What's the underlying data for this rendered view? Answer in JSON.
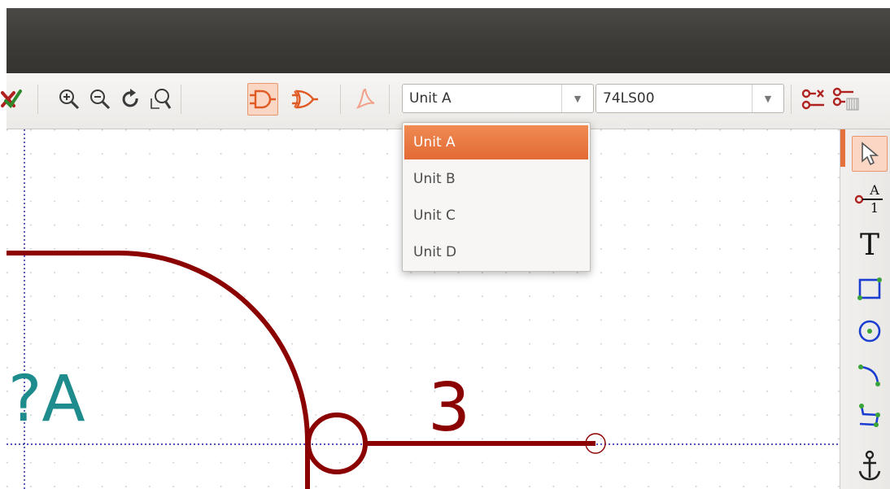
{
  "toolbar": {
    "buttons": [
      {
        "name": "delete-icon"
      },
      {
        "name": "zoom-in-icon"
      },
      {
        "name": "zoom-out-icon"
      },
      {
        "name": "redraw-icon"
      },
      {
        "name": "zoom-fit-icon"
      },
      {
        "name": "and-gate-icon",
        "active": true
      },
      {
        "name": "or-gate-icon"
      },
      {
        "name": "pdf-icon"
      }
    ],
    "unit_select": {
      "value": "Unit A",
      "expanded": true
    },
    "part_select": {
      "value": "74LS00"
    },
    "right_buttons": [
      {
        "name": "pin-table-icon"
      },
      {
        "name": "pin-list-icon"
      }
    ]
  },
  "unit_dropdown": {
    "options": [
      "Unit A",
      "Unit B",
      "Unit C",
      "Unit D"
    ],
    "selected": "Unit A"
  },
  "canvas": {
    "reference_text": "?A",
    "pin_number": "3",
    "colors": {
      "graphic": "#8b0000",
      "reference": "#1e8c8c",
      "grid": "#c8c8c8",
      "axis": "#1a1aa6"
    }
  },
  "right_toolbar": {
    "tools": [
      {
        "name": "select-arrow-icon",
        "active": true
      },
      {
        "name": "add-pin-icon",
        "glyph_top": "A",
        "glyph_bottom": "1"
      },
      {
        "name": "text-tool-icon",
        "glyph": "T"
      },
      {
        "name": "rectangle-tool-icon"
      },
      {
        "name": "circle-tool-icon"
      },
      {
        "name": "arc-tool-icon"
      },
      {
        "name": "polyline-tool-icon"
      },
      {
        "name": "anchor-icon"
      }
    ]
  },
  "colors": {
    "accent": "#e5703c",
    "titlebar": "#3c3b37"
  }
}
